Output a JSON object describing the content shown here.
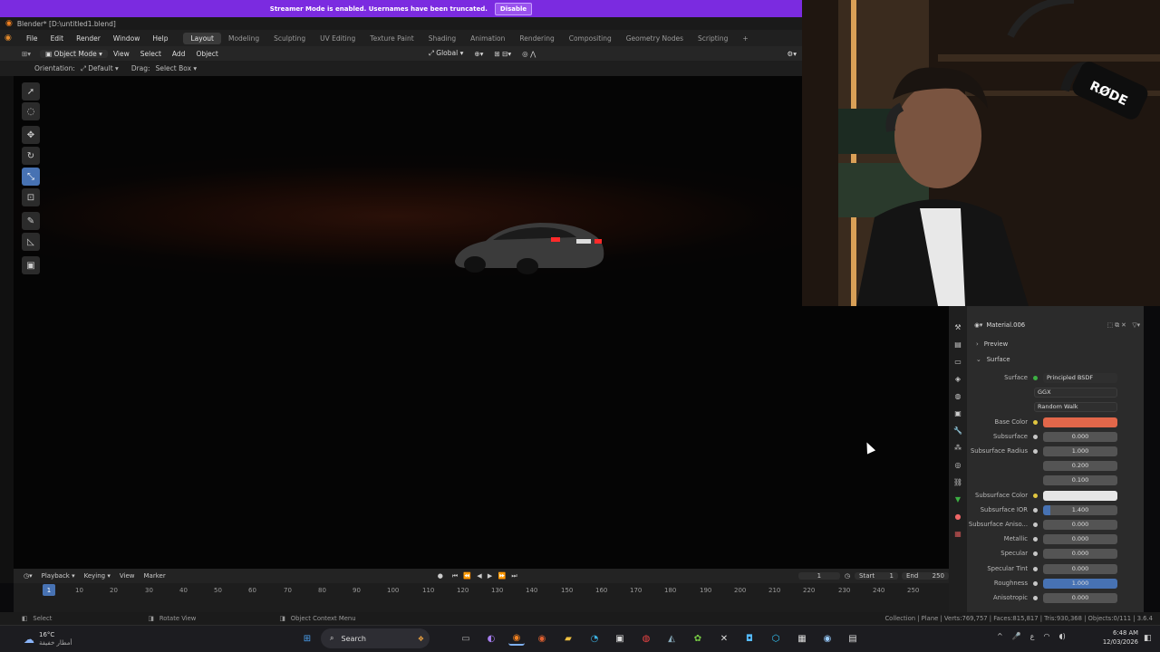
{
  "banner": {
    "text": "Streamer Mode is enabled. Usernames have been truncated.",
    "button": "Disable"
  },
  "window": {
    "title": "Blender* [D:\\untitled1.blend]"
  },
  "menu": [
    "File",
    "Edit",
    "Render",
    "Window",
    "Help"
  ],
  "workspaces": [
    "Layout",
    "Modeling",
    "Sculpting",
    "UV Editing",
    "Texture Paint",
    "Shading",
    "Animation",
    "Rendering",
    "Compositing",
    "Geometry Nodes",
    "Scripting",
    "+"
  ],
  "active_workspace": "Layout",
  "header": {
    "mode": "Object Mode",
    "view": "View",
    "select": "Select",
    "add": "Add",
    "object": "Object",
    "transform": "Global"
  },
  "header2": {
    "orientation_label": "Orientation:",
    "orientation_value": "Default",
    "drag_label": "Drag:",
    "drag_value": "Select Box"
  },
  "properties": {
    "material": "Material.006",
    "preview": "Preview",
    "surface_panel": "Surface",
    "rows": [
      {
        "label": "Surface",
        "value": "Principled BSDF",
        "kind": "node"
      },
      {
        "label": "",
        "value": "GGX",
        "kind": "dropdown"
      },
      {
        "label": "",
        "value": "Random Walk",
        "kind": "dropdown"
      },
      {
        "label": "Base Color",
        "value": "",
        "kind": "color",
        "color": "#e2674a"
      },
      {
        "label": "Subsurface",
        "value": "0.000",
        "kind": "number"
      },
      {
        "label": "Subsurface Radius",
        "value": "1.000",
        "kind": "number"
      },
      {
        "label": "",
        "value": "0.200",
        "kind": "number"
      },
      {
        "label": "",
        "value": "0.100",
        "kind": "number"
      },
      {
        "label": "Subsurface Color",
        "value": "",
        "kind": "color",
        "color": "#e6e6e6"
      },
      {
        "label": "Subsurface IOR",
        "value": "1.400",
        "kind": "slider"
      },
      {
        "label": "Subsurface Aniso...",
        "value": "0.000",
        "kind": "number"
      },
      {
        "label": "Metallic",
        "value": "0.000",
        "kind": "number"
      },
      {
        "label": "Specular",
        "value": "0.000",
        "kind": "number"
      },
      {
        "label": "Specular Tint",
        "value": "0.000",
        "kind": "number"
      },
      {
        "label": "Roughness",
        "value": "1.000",
        "kind": "slider-full"
      },
      {
        "label": "Anisotropic",
        "value": "0.000",
        "kind": "number"
      }
    ]
  },
  "timeline": {
    "menus": [
      "Playback",
      "Keying",
      "View",
      "Marker"
    ],
    "current_frame": "1",
    "start_label": "Start",
    "start": "1",
    "end_label": "End",
    "end": "250",
    "ticks": [
      "10",
      "20",
      "30",
      "40",
      "50",
      "60",
      "70",
      "80",
      "90",
      "100",
      "110",
      "120",
      "130",
      "140",
      "150",
      "160",
      "170",
      "180",
      "190",
      "200",
      "210",
      "220",
      "230",
      "240",
      "250"
    ],
    "playhead": "1"
  },
  "status": {
    "select": "Select",
    "rotate": "Rotate View",
    "context": "Object Context Menu",
    "stats": "Collection | Plane | Verts:769,757 | Faces:815,817 | Tris:930,368 | Objects:0/111 | 3.6.4"
  },
  "taskbar": {
    "weather_temp": "16°C",
    "weather_desc": "أمطار خفيفة",
    "search": "Search",
    "time": "6:48 AM",
    "date": "12/03/2026"
  },
  "webcam": {
    "brand": "RØDE"
  }
}
